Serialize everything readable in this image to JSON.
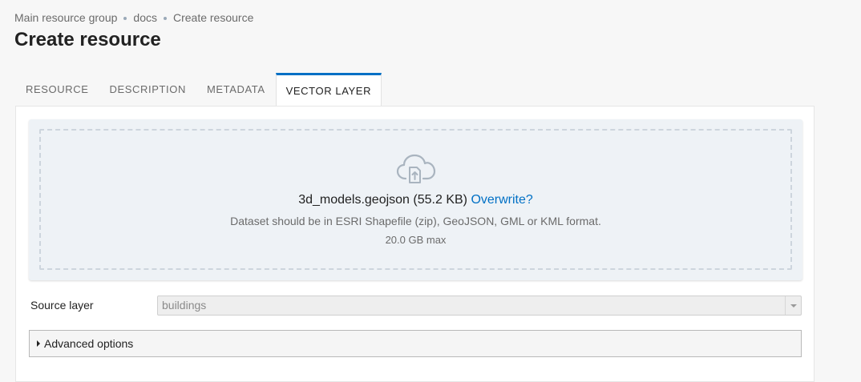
{
  "breadcrumb": {
    "items": [
      "Main resource group",
      "docs",
      "Create resource"
    ]
  },
  "page_title": "Create resource",
  "tabs": [
    {
      "label": "RESOURCE",
      "active": false
    },
    {
      "label": "DESCRIPTION",
      "active": false
    },
    {
      "label": "METADATA",
      "active": false
    },
    {
      "label": "VECTOR LAYER",
      "active": true
    }
  ],
  "upload": {
    "icon": "cloud-upload-icon",
    "file_info": "3d_models.geojson (55.2 KB)",
    "overwrite_label": "Overwrite?",
    "hint": "Dataset should be in ESRI Shapefile (zip), GeoJSON, GML or KML format.",
    "max_size": "20.0 GB max"
  },
  "source_layer": {
    "label": "Source layer",
    "value": "buildings"
  },
  "advanced": {
    "label": "Advanced options"
  },
  "colors": {
    "accent": "#0070c5",
    "dropzone_bg": "#eef2f6"
  }
}
